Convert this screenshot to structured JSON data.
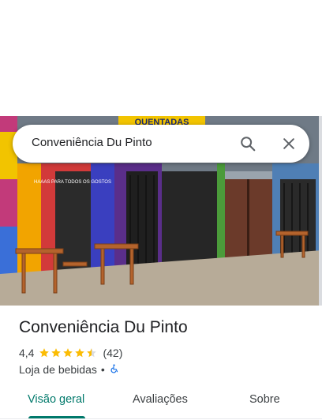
{
  "search": {
    "query": "Conveniência Du Pinto",
    "search_icon": "search-icon",
    "close_icon": "close-icon"
  },
  "photo": {
    "sign_text": "QUENTADAS",
    "wall_text": "HAAAS PARA TODOS OS GOSTOS"
  },
  "place": {
    "name": "Conveniência Du Pinto",
    "rating": "4,4",
    "rating_value": 4.4,
    "stars_max": 5,
    "review_count": "(42)",
    "category": "Loja de bebidas",
    "separator": "•",
    "accessibility_icon": "wheelchair-icon"
  },
  "tabs": [
    {
      "label": "Visão geral",
      "selected": true
    },
    {
      "label": "Avaliações",
      "selected": false
    },
    {
      "label": "Sobre",
      "selected": false
    }
  ],
  "colors": {
    "accent": "#00796b",
    "star": "#fbbc04",
    "accessibility": "#1a73e8"
  }
}
